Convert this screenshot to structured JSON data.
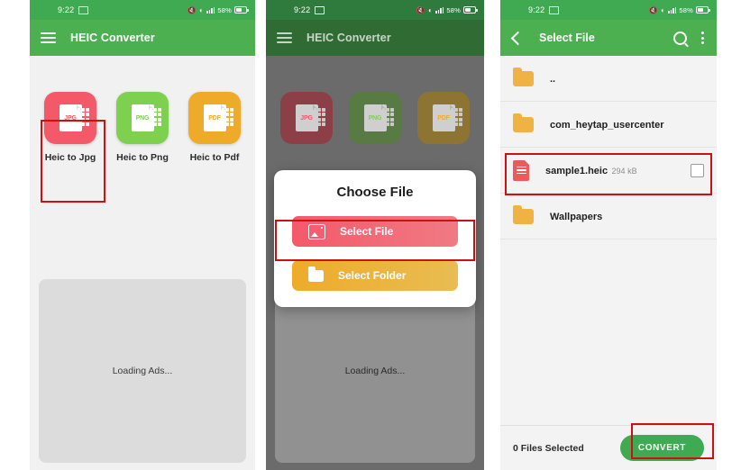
{
  "status_bar": {
    "time": "9:22",
    "cast_icon": "cast-icon",
    "mute_icon": "volume-mute-icon",
    "wifi_icon": "wifi-icon",
    "signal_icon": "signal-bars-icon",
    "battery_percent": "58%"
  },
  "panel1": {
    "appbar": {
      "menu_icon": "hamburger-menu-icon",
      "title": "HEIC Converter"
    },
    "cards": [
      {
        "label": "Heic to Jpg",
        "format": "JPG",
        "color": "#f4596a",
        "highlighted": true
      },
      {
        "label": "Heic to Png",
        "format": "PNG",
        "color": "#7ed04f",
        "highlighted": false
      },
      {
        "label": "Heic to Pdf",
        "format": "PDF",
        "color": "#eeab2a",
        "highlighted": false
      }
    ],
    "ad_text": "Loading Ads..."
  },
  "panel2": {
    "appbar": {
      "menu_icon": "hamburger-menu-icon",
      "title": "HEIC Converter"
    },
    "cards": [
      {
        "label": "Heic to Jpg",
        "format": "JPG"
      },
      {
        "label": "Heic to Png",
        "format": "PNG"
      },
      {
        "label": "Heic to Pdf",
        "format": "PDF"
      }
    ],
    "ad_text": "Loading Ads...",
    "dialog": {
      "title": "Choose File",
      "select_file_label": "Select File",
      "select_file_icon": "image-icon",
      "select_folder_label": "Select Folder",
      "select_folder_icon": "folder-icon"
    }
  },
  "panel3": {
    "appbar": {
      "back_icon": "back-arrow-icon",
      "title": "Select File",
      "search_icon": "search-icon",
      "overflow_icon": "more-vertical-icon"
    },
    "rows": [
      {
        "name": "..",
        "type": "folder",
        "size": "",
        "checkbox": false
      },
      {
        "name": "com_heytap_usercenter",
        "type": "folder",
        "size": "",
        "checkbox": false
      },
      {
        "name": "sample1.heic",
        "type": "file",
        "size": "294 kB",
        "checkbox": true,
        "highlighted": true
      },
      {
        "name": "Wallpapers",
        "type": "folder",
        "size": "",
        "checkbox": false
      }
    ],
    "footer": {
      "selected_text": "0  Files Selected",
      "convert_label": "CONVERT",
      "convert_color": "#3faa52"
    }
  },
  "annotation_color": "#cc1111"
}
